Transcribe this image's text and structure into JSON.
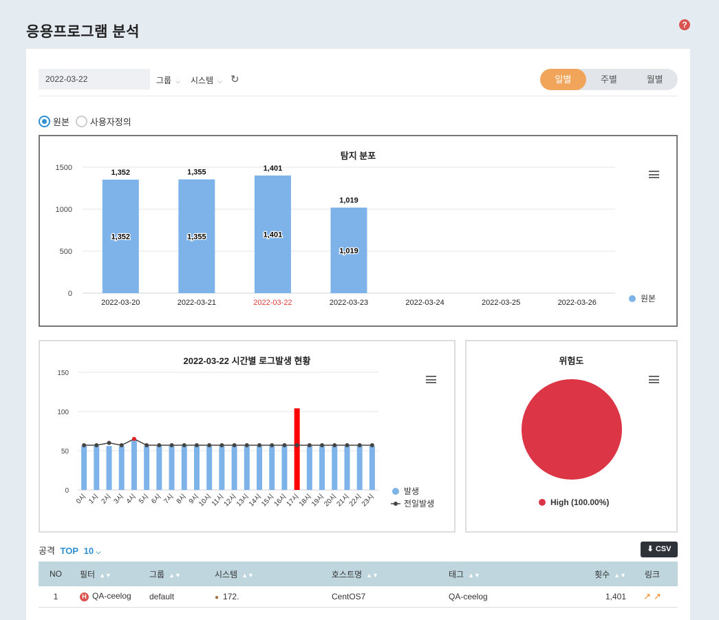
{
  "page": {
    "title": "응용프로그램 분석"
  },
  "toolbar": {
    "date": "2022-03-22",
    "group_label": "그룹",
    "system_label": "시스템",
    "period_tabs": [
      "일별",
      "주별",
      "월별"
    ],
    "active_period": "일별"
  },
  "radios": {
    "original": "원본",
    "custom": "사용자정의"
  },
  "colors": {
    "bar": "#7db3e8",
    "highlight": "#ff0000",
    "accent": "#2f8fd3",
    "orange": "#f0a55a",
    "pie": "#dc3545",
    "line": "#444444"
  },
  "chart_data": [
    {
      "type": "bar",
      "title": "탐지 분포",
      "categories": [
        "2022-03-20",
        "2022-03-21",
        "2022-03-22",
        "2022-03-23",
        "2022-03-24",
        "2022-03-25",
        "2022-03-26"
      ],
      "highlight_category": "2022-03-22",
      "series": [
        {
          "name": "원본",
          "values": [
            1352,
            1355,
            1401,
            1019,
            null,
            null,
            null
          ]
        }
      ],
      "labels": [
        "1,352",
        "1,355",
        "1,401",
        "1,019",
        "",
        "",
        ""
      ],
      "ylim": [
        0,
        1500
      ],
      "yticks": [
        0,
        500,
        1000,
        1500
      ]
    },
    {
      "type": "bar",
      "title": "2022-03-22 시간별 로그발생 현황",
      "categories": [
        "0시",
        "1시",
        "2시",
        "3시",
        "4시",
        "5시",
        "6시",
        "7시",
        "8시",
        "9시",
        "10시",
        "11시",
        "12시",
        "13시",
        "14시",
        "15시",
        "16시",
        "17시",
        "18시",
        "19시",
        "20시",
        "21시",
        "22시",
        "23시"
      ],
      "series": [
        {
          "name": "발생",
          "values": [
            56,
            56,
            56,
            56,
            63,
            56,
            56,
            56,
            56,
            56,
            56,
            56,
            56,
            56,
            56,
            56,
            56,
            104,
            56,
            56,
            56,
            56,
            56,
            56
          ]
        },
        {
          "name": "전일발생",
          "values": [
            57,
            57,
            60,
            57,
            65,
            57,
            57,
            57,
            57,
            57,
            57,
            57,
            57,
            57,
            57,
            57,
            57,
            57,
            57,
            57,
            57,
            57,
            57,
            57
          ]
        }
      ],
      "highlight_index": 17,
      "ylim": [
        0,
        150
      ],
      "yticks": [
        0,
        50,
        100,
        150
      ]
    },
    {
      "type": "pie",
      "title": "위험도",
      "slices": [
        {
          "name": "High",
          "value": 100,
          "label": "High (100.00%)"
        }
      ]
    }
  ],
  "top": {
    "prefix": "공격",
    "top_label": "TOP",
    "count": "10",
    "csv_label": "CSV"
  },
  "table": {
    "headers": [
      "NO",
      "필터",
      "그룹",
      "시스템",
      "호스트명",
      "태그",
      "횟수",
      "링크"
    ],
    "rows": [
      {
        "no": "1",
        "filter": "QA-ceelog",
        "badge": "H",
        "group": "default",
        "system": "172.",
        "host": "CentOS7",
        "tag": "QA-ceelog",
        "count": "1,401"
      }
    ]
  }
}
